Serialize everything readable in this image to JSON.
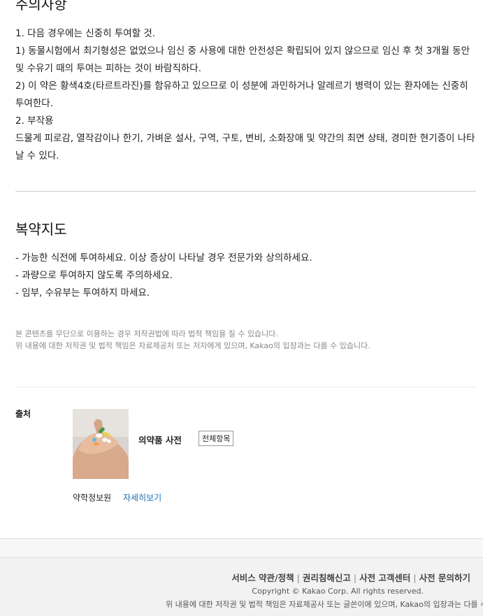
{
  "caution": {
    "title": "주의사항",
    "lines": [
      "1. 다음 경우에는 신중히 투여할 것.",
      "1) 동물시험에서 최기형성은 없었으나 임신 중 사용에 대한 안전성은 확립되어 있지 않으므로 임신 후 첫 3개월 동안 및 수유기 때의 투여는 피하는 것이 바람직하다.",
      "2) 이 약은 황색4호(타르트라진)를 함유하고 있으므로 이 성분에 과민하거나 알레르기 병력이 있는 환자에는 신중히 투여한다.",
      "2. 부작용",
      "드물게 피로감, 열작감이나 한기, 가벼운 설사, 구역, 구토, 변비, 소화장애 및 약간의 최면 상태, 경미한 현기증이 나타날 수 있다."
    ]
  },
  "guidance": {
    "title": "복약지도",
    "lines": [
      "- 가능한 식전에 투여하세요. 이상 증상이 나타날 경우 전문가와 상의하세요.",
      "- 과량으로 투여하지 않도록 주의하세요.",
      "- 임부, 수유부는 투여하지 마세요."
    ]
  },
  "notice": {
    "line1": "본 콘텐츠를 무단으로 이용하는 경우 저작권법에 따라 법적 책임을 질 수 있습니다.",
    "line2": "위 내용에 대한 저작권 및 법적 책임은 자료제공처 또는 저자에게 있으며, Kakao의 입장과는 다를 수 있습니다."
  },
  "source": {
    "label": "출처",
    "book_title": "의약품 사전",
    "all_items_button": "전체항목",
    "publisher": "약학정보원",
    "detail_link": "자세히보기"
  },
  "footer": {
    "links": [
      "서비스 약관/정책",
      "권리침해신고",
      "사전 고객센터",
      "사전 문의하기"
    ],
    "copyright": "Copyright © Kakao Corp. All rights reserved.",
    "note": "위 내용에 대한 저작권 및 법적 책임은 자료제공사 또는 글쓴이에 있으며, Kakao의 입장과는 다를 수 있"
  }
}
